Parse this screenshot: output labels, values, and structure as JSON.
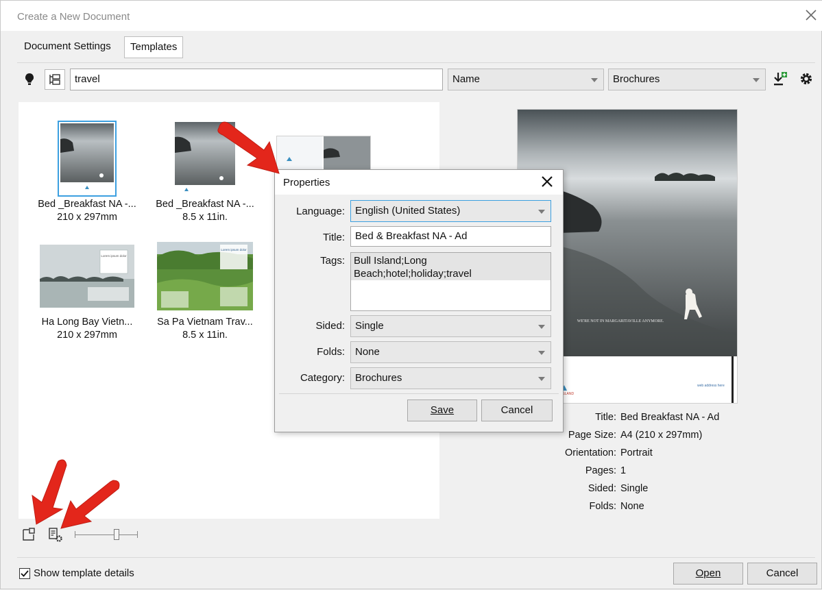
{
  "window": {
    "title": "Create a New Document"
  },
  "tabs": [
    {
      "label": "Document Settings"
    },
    {
      "label": "Templates"
    }
  ],
  "toolbar": {
    "search_value": "travel",
    "sort_value": "Name",
    "category_value": "Brochures"
  },
  "templates": [
    {
      "name": "Bed _Breakfast NA -...",
      "size": "210 x 297mm"
    },
    {
      "name": "Bed _Breakfast NA -...",
      "size": "8.5 x 11in."
    },
    {
      "name": "Ha Long Bay Vietn...",
      "size": "210 x 297mm"
    },
    {
      "name": "Sa Pa Vietnam Trav...",
      "size": "8.5 x 11in."
    }
  ],
  "thumb_text": {
    "lorem": "Lorem ipsum dolor",
    "preview_tagline": "WE'RE NOT IN MARGARITAVILLE ANYMORE.",
    "web_address": "web address here",
    "island": "ISLAND"
  },
  "properties": {
    "title": "Properties",
    "language_label": "Language:",
    "language_value": "English (United States)",
    "title_label": "Title:",
    "title_value": "Bed & Breakfast NA - Ad",
    "tags_label": "Tags:",
    "tags_value": "Bull Island;Long Beach;hotel;holiday;travel",
    "sided_label": "Sided:",
    "sided_value": "Single",
    "folds_label": "Folds:",
    "folds_value": "None",
    "category_label": "Category:",
    "category_value": "Brochures",
    "save_label": "Save",
    "cancel_label": "Cancel"
  },
  "details": [
    {
      "label": "Title:",
      "value": "Bed  Breakfast NA - Ad"
    },
    {
      "label": "Page Size:",
      "value": "A4 (210 x 297mm)"
    },
    {
      "label": "Orientation:",
      "value": "Portrait"
    },
    {
      "label": "Pages:",
      "value": "1"
    },
    {
      "label": "Sided:",
      "value": "Single"
    },
    {
      "label": "Folds:",
      "value": "None"
    }
  ],
  "footer": {
    "show_details_label": "Show template details",
    "show_details_checked": true,
    "open_label": "Open",
    "cancel_label": "Cancel"
  },
  "colors": {
    "accent": "#3b9fe0",
    "annotation_arrow": "#e3261b"
  }
}
